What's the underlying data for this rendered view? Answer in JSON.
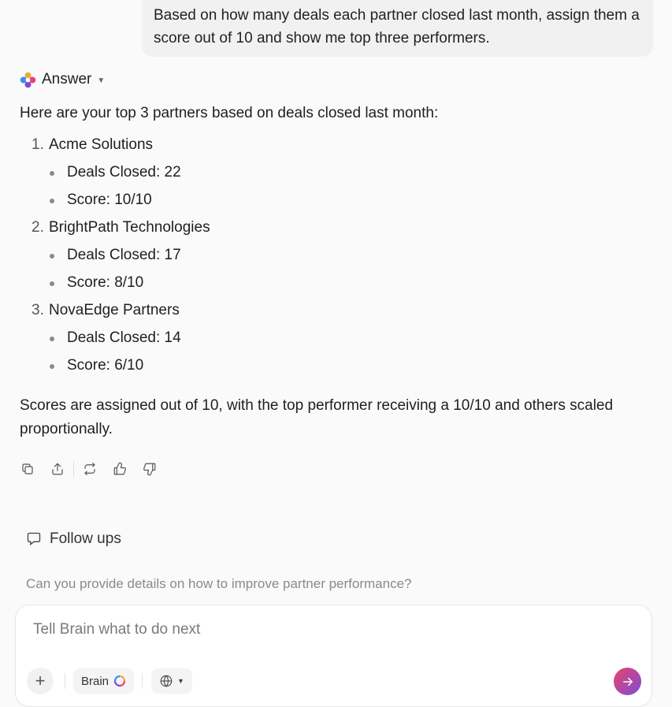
{
  "user_message": "Based on how many deals each partner closed last month, assign them a score out of 10 and show me top three performers.",
  "answer": {
    "label": "Answer",
    "intro": "Here are your top 3 partners based on deals closed last month:",
    "partners": [
      {
        "num": "1.",
        "name": "Acme Solutions",
        "deals": "Deals Closed: 22",
        "score": "Score: 10/10"
      },
      {
        "num": "2.",
        "name": "BrightPath Technologies",
        "deals": "Deals Closed: 17",
        "score": "Score: 8/10"
      },
      {
        "num": "3.",
        "name": "NovaEdge Partners",
        "deals": "Deals Closed: 14",
        "score": "Score: 6/10"
      }
    ],
    "summary": "Scores are assigned out of 10, with the top performer receiving a 10/10 and others scaled proportionally."
  },
  "actions": [
    "copy-icon",
    "share-icon",
    "regenerate-icon",
    "thumbs-up-icon",
    "thumbs-down-icon"
  ],
  "followups": {
    "title": "Follow ups",
    "suggestion": "Can you provide details on how to improve partner performance?"
  },
  "composer": {
    "placeholder": "Tell Brain what to do next",
    "brain_label": "Brain"
  },
  "colors": {
    "accent_start": "#e8446b",
    "accent_end": "#7d4bd8"
  }
}
